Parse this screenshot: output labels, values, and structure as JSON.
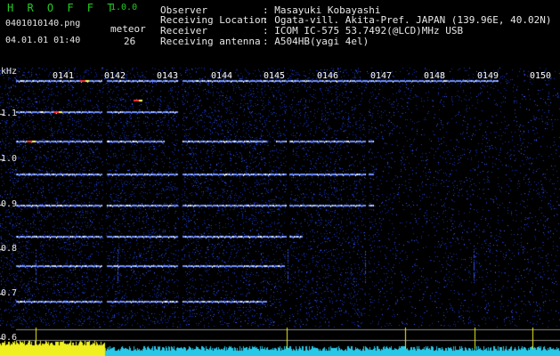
{
  "app": {
    "name": "H R O F F T",
    "version": "1.0.0"
  },
  "file": {
    "name": "0401010140.png",
    "datetime": "04.01.01 01:40"
  },
  "meteor": {
    "label": "meteor",
    "count": "26"
  },
  "header": [
    {
      "label": "Observer",
      "value": ": Masayuki Kobayashi"
    },
    {
      "label": "Receiving Location",
      "value": ": Ogata-vill. Akita-Pref. JAPAN (139.96E, 40.02N)"
    },
    {
      "label": "Receiver",
      "value": ": ICOM IC-575 53.7492(@LCD)MHz USB"
    },
    {
      "label": "Receiving antenna",
      "value": ": A504HB(yagi 4el)"
    }
  ],
  "axis": {
    "y_unit": "kHz",
    "y_ticks": [
      "1.1",
      "1.0",
      "0.9",
      "0.8",
      "0.7",
      "0.6"
    ],
    "x_ticks": [
      "0141",
      "0142",
      "0143",
      "0144",
      "0145",
      "0146",
      "0147",
      "0148",
      "0149",
      "0150"
    ]
  },
  "colors": {
    "background": "#000000",
    "noise": "#1030b0",
    "trace": "#c8d8ff",
    "meteor_hit": "#ff3030",
    "power_low": "#28c8e8",
    "power_high": "#f0f020",
    "app_name": "#22cc22"
  }
}
